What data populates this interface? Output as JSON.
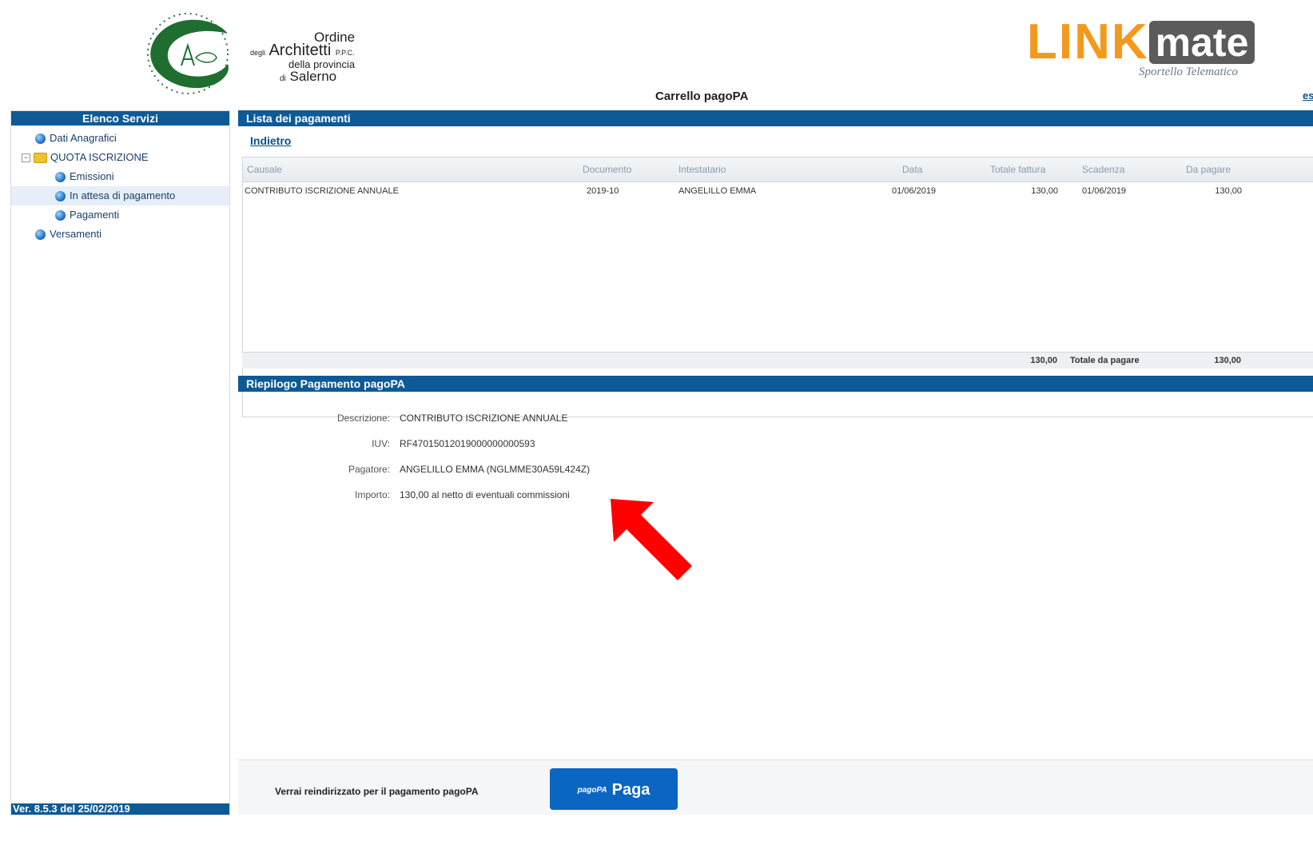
{
  "header": {
    "logo": {
      "l1": "Ordine",
      "l2a": "degli",
      "l2b": "Architetti",
      "l2c": "P.P.C.",
      "l3": "della provincia",
      "l4a": "di",
      "l4b": "Salerno"
    },
    "brand": {
      "link": "LINK",
      "mate": "mate",
      "sub": "Sportello Telematico"
    },
    "cart_title": "Carrello pagoPA",
    "exit": "esci"
  },
  "sidebar": {
    "title": "Elenco Servizi",
    "items": [
      {
        "label": "Dati Anagrafici"
      },
      {
        "label": "QUOTA ISCRIZIONE"
      },
      {
        "label": "Emissioni"
      },
      {
        "label": "In attesa di pagamento"
      },
      {
        "label": "Pagamenti"
      },
      {
        "label": "Versamenti"
      }
    ],
    "footer": "Ver. 8.5.3 del 25/02/2019"
  },
  "main": {
    "list_title": "Lista dei pagamenti",
    "back": "Indietro",
    "columns": [
      "Causale",
      "Documento",
      "Intestatario",
      "Data",
      "Totale fattura",
      "Scadenza",
      "Da pagare"
    ],
    "rows": [
      [
        "CONTRIBUTO ISCRIZIONE ANNUALE",
        "2019-10",
        "ANGELILLO EMMA",
        "01/06/2019",
        "130,00",
        "01/06/2019",
        "130,00"
      ]
    ],
    "total": {
      "sum": "130,00",
      "label": "Totale da pagare",
      "value": "130,00"
    },
    "summary_title": "Riepilogo Pagamento pagoPA",
    "summary": {
      "descrizione_label": "Descrizione:",
      "descrizione": "CONTRIBUTO ISCRIZIONE ANNUALE",
      "iuv_label": "IUV:",
      "iuv": "RF47015012019000000000593",
      "pagatore_label": "Pagatore:",
      "pagatore": "ANGELILLO EMMA (NGLMME30A59L424Z)",
      "importo_label": "Importo:",
      "importo": "130,00 al netto di eventuali commissioni"
    },
    "pay_message": "Verrai reindirizzato per il pagamento pagoPA",
    "pay_button": "Paga",
    "pay_logo": "pagoPA"
  },
  "colors": {
    "bar": "#0d5a96",
    "brand_orange": "#f39a1c",
    "pay_button": "#0b66c3",
    "arrow": "#ff0000"
  }
}
